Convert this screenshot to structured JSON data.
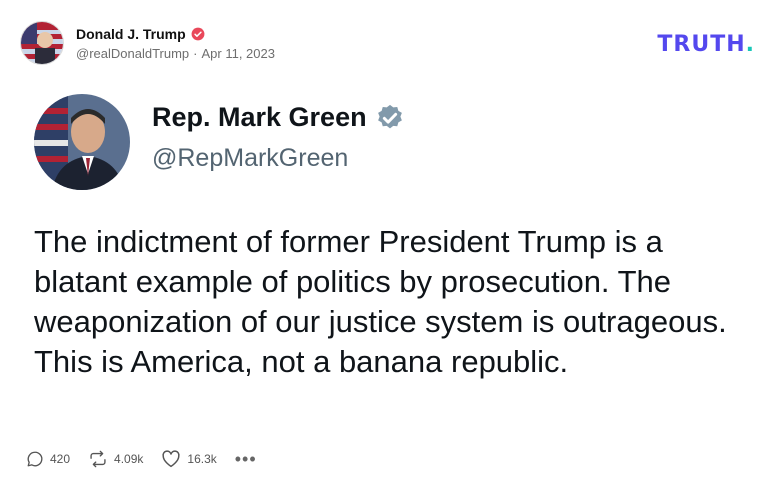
{
  "post": {
    "author_name": "Donald J. Trump",
    "handle": "@realDonaldTrump",
    "separator": "·",
    "date": "Apr 11, 2023"
  },
  "brand": {
    "logo_text": "TRUTH",
    "logo_dot": "."
  },
  "quoted": {
    "name": "Rep. Mark Green",
    "handle": "@RepMarkGreen",
    "text": "The indictment of former President Trump is a blatant example of politics by prosecution. The weaponization of our justice system is outrageous. This is America, not a banana republic."
  },
  "actions": {
    "replies": "420",
    "retruths": "4.09k",
    "likes": "16.3k",
    "more": "•••"
  },
  "colors": {
    "brand": "#5448ee",
    "brand_dot": "#17c7b8",
    "verified_small": "#e9485a",
    "verified_large": "#829aab"
  },
  "icons": [
    "reply-icon",
    "retruth-icon",
    "heart-icon",
    "more-icon",
    "verified-icon"
  ]
}
